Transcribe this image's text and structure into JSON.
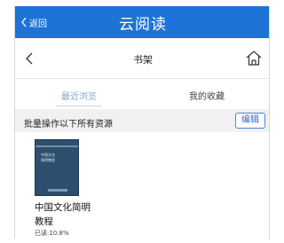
{
  "app": {
    "title": "云阅读",
    "back_label": "返回",
    "brand_color": "#1e73d6"
  },
  "nav": {
    "title": "书架",
    "back_icon": "chevron-left-icon",
    "home_icon": "home-icon"
  },
  "tabs": [
    {
      "label": "最近浏览",
      "active": true
    },
    {
      "label": "我的收藏",
      "active": false
    }
  ],
  "batch": {
    "label": "批量操作以下所有资源",
    "edit_label": "编辑"
  },
  "books": [
    {
      "title": "中国文化简明教程",
      "cover_title": "中国文化\n简明教程",
      "progress": "已读:10.8%"
    }
  ]
}
